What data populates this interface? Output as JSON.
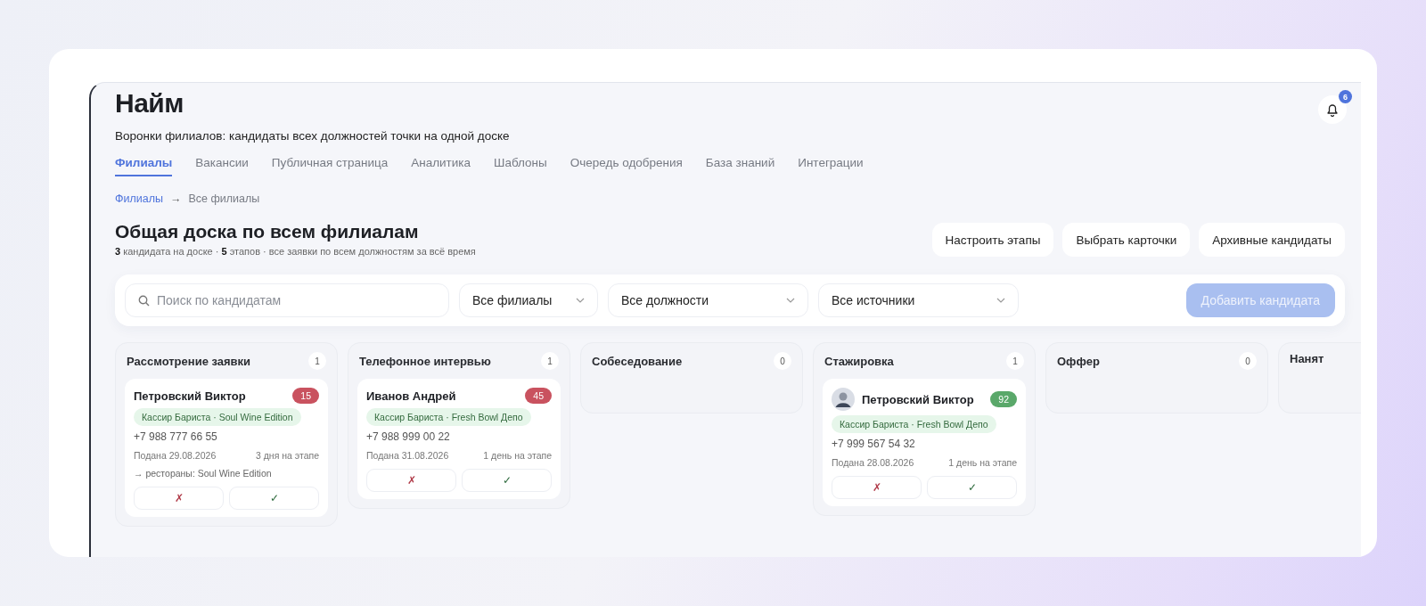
{
  "page": {
    "title": "Найм",
    "subtitle": "Воронки филиалов: кандидаты всех должностей точки на одной доске",
    "notifications": "6"
  },
  "tabs": [
    {
      "label": "Филиалы",
      "selected": true
    },
    {
      "label": "Вакансии",
      "selected": false
    },
    {
      "label": "Публичная страница",
      "selected": false
    },
    {
      "label": "Аналитика",
      "selected": false
    },
    {
      "label": "Шаблоны",
      "selected": false
    },
    {
      "label": "Очередь одобрения",
      "selected": false
    },
    {
      "label": "База знаний",
      "selected": false
    },
    {
      "label": "Интеграции",
      "selected": false
    }
  ],
  "breadcrumb": {
    "link": "Филиалы",
    "separator": "→",
    "current": "Все филиалы"
  },
  "board": {
    "title": "Общая доска по всем филиалам",
    "summary": "**3** кандидата на доске · **5** этапов · все заявки по всем должностям за всё время",
    "actions": [
      "Настроить этапы",
      "Выбрать карточки",
      "Архивные кандидаты"
    ]
  },
  "filters": {
    "search": {
      "placeholder": "Поиск по кандидатам"
    },
    "selects": [
      "Все филиалы",
      "Все должности",
      "Все источники"
    ],
    "add_button": {
      "label": "Добавить кандидата",
      "disabled": true
    }
  },
  "columns": [
    {
      "title": "Рассмотрение заявки",
      "count": "1",
      "cards": [
        {
          "name": "Петровский Виктор",
          "photo": false,
          "score": "15",
          "color": "#c9525f",
          "tag": "Кассир Бариста · Soul Wine Edition",
          "phone": "+7 988 777 66 55",
          "submitted": "Подана 29.08.2026",
          "days": "3 дня на этапе",
          "note": "→ рестораны: Soul Wine Edition",
          "reject": "✗",
          "accept": "✓"
        }
      ]
    },
    {
      "title": "Телефонное интервью",
      "count": "1",
      "cards": [
        {
          "name": "Иванов Андрей",
          "photo": false,
          "score": "45",
          "color": "#c9525f",
          "tag": "Кассир Бариста · Fresh Bowl Депо",
          "phone": "+7 988 999 00 22",
          "submitted": "Подана 31.08.2026",
          "days": "1 день на этапе",
          "reject": "✗",
          "accept": "✓"
        }
      ]
    },
    {
      "title": "Собеседование",
      "count": "0"
    },
    {
      "title": "Стажировка",
      "count": "1",
      "cards": [
        {
          "name": "Петровский Виктор",
          "photo": true,
          "score": "92",
          "color": "#5aa86a",
          "tag": "Кассир Бариста · Fresh Bowl Депо",
          "phone": "+7 999 567 54 32",
          "submitted": "Подана 28.08.2026",
          "days": "1 день на этапе",
          "reject": "✗",
          "accept": "✓"
        }
      ]
    },
    {
      "title": "Оффер",
      "count": "0"
    },
    {
      "title": "Нанят"
    }
  ]
}
